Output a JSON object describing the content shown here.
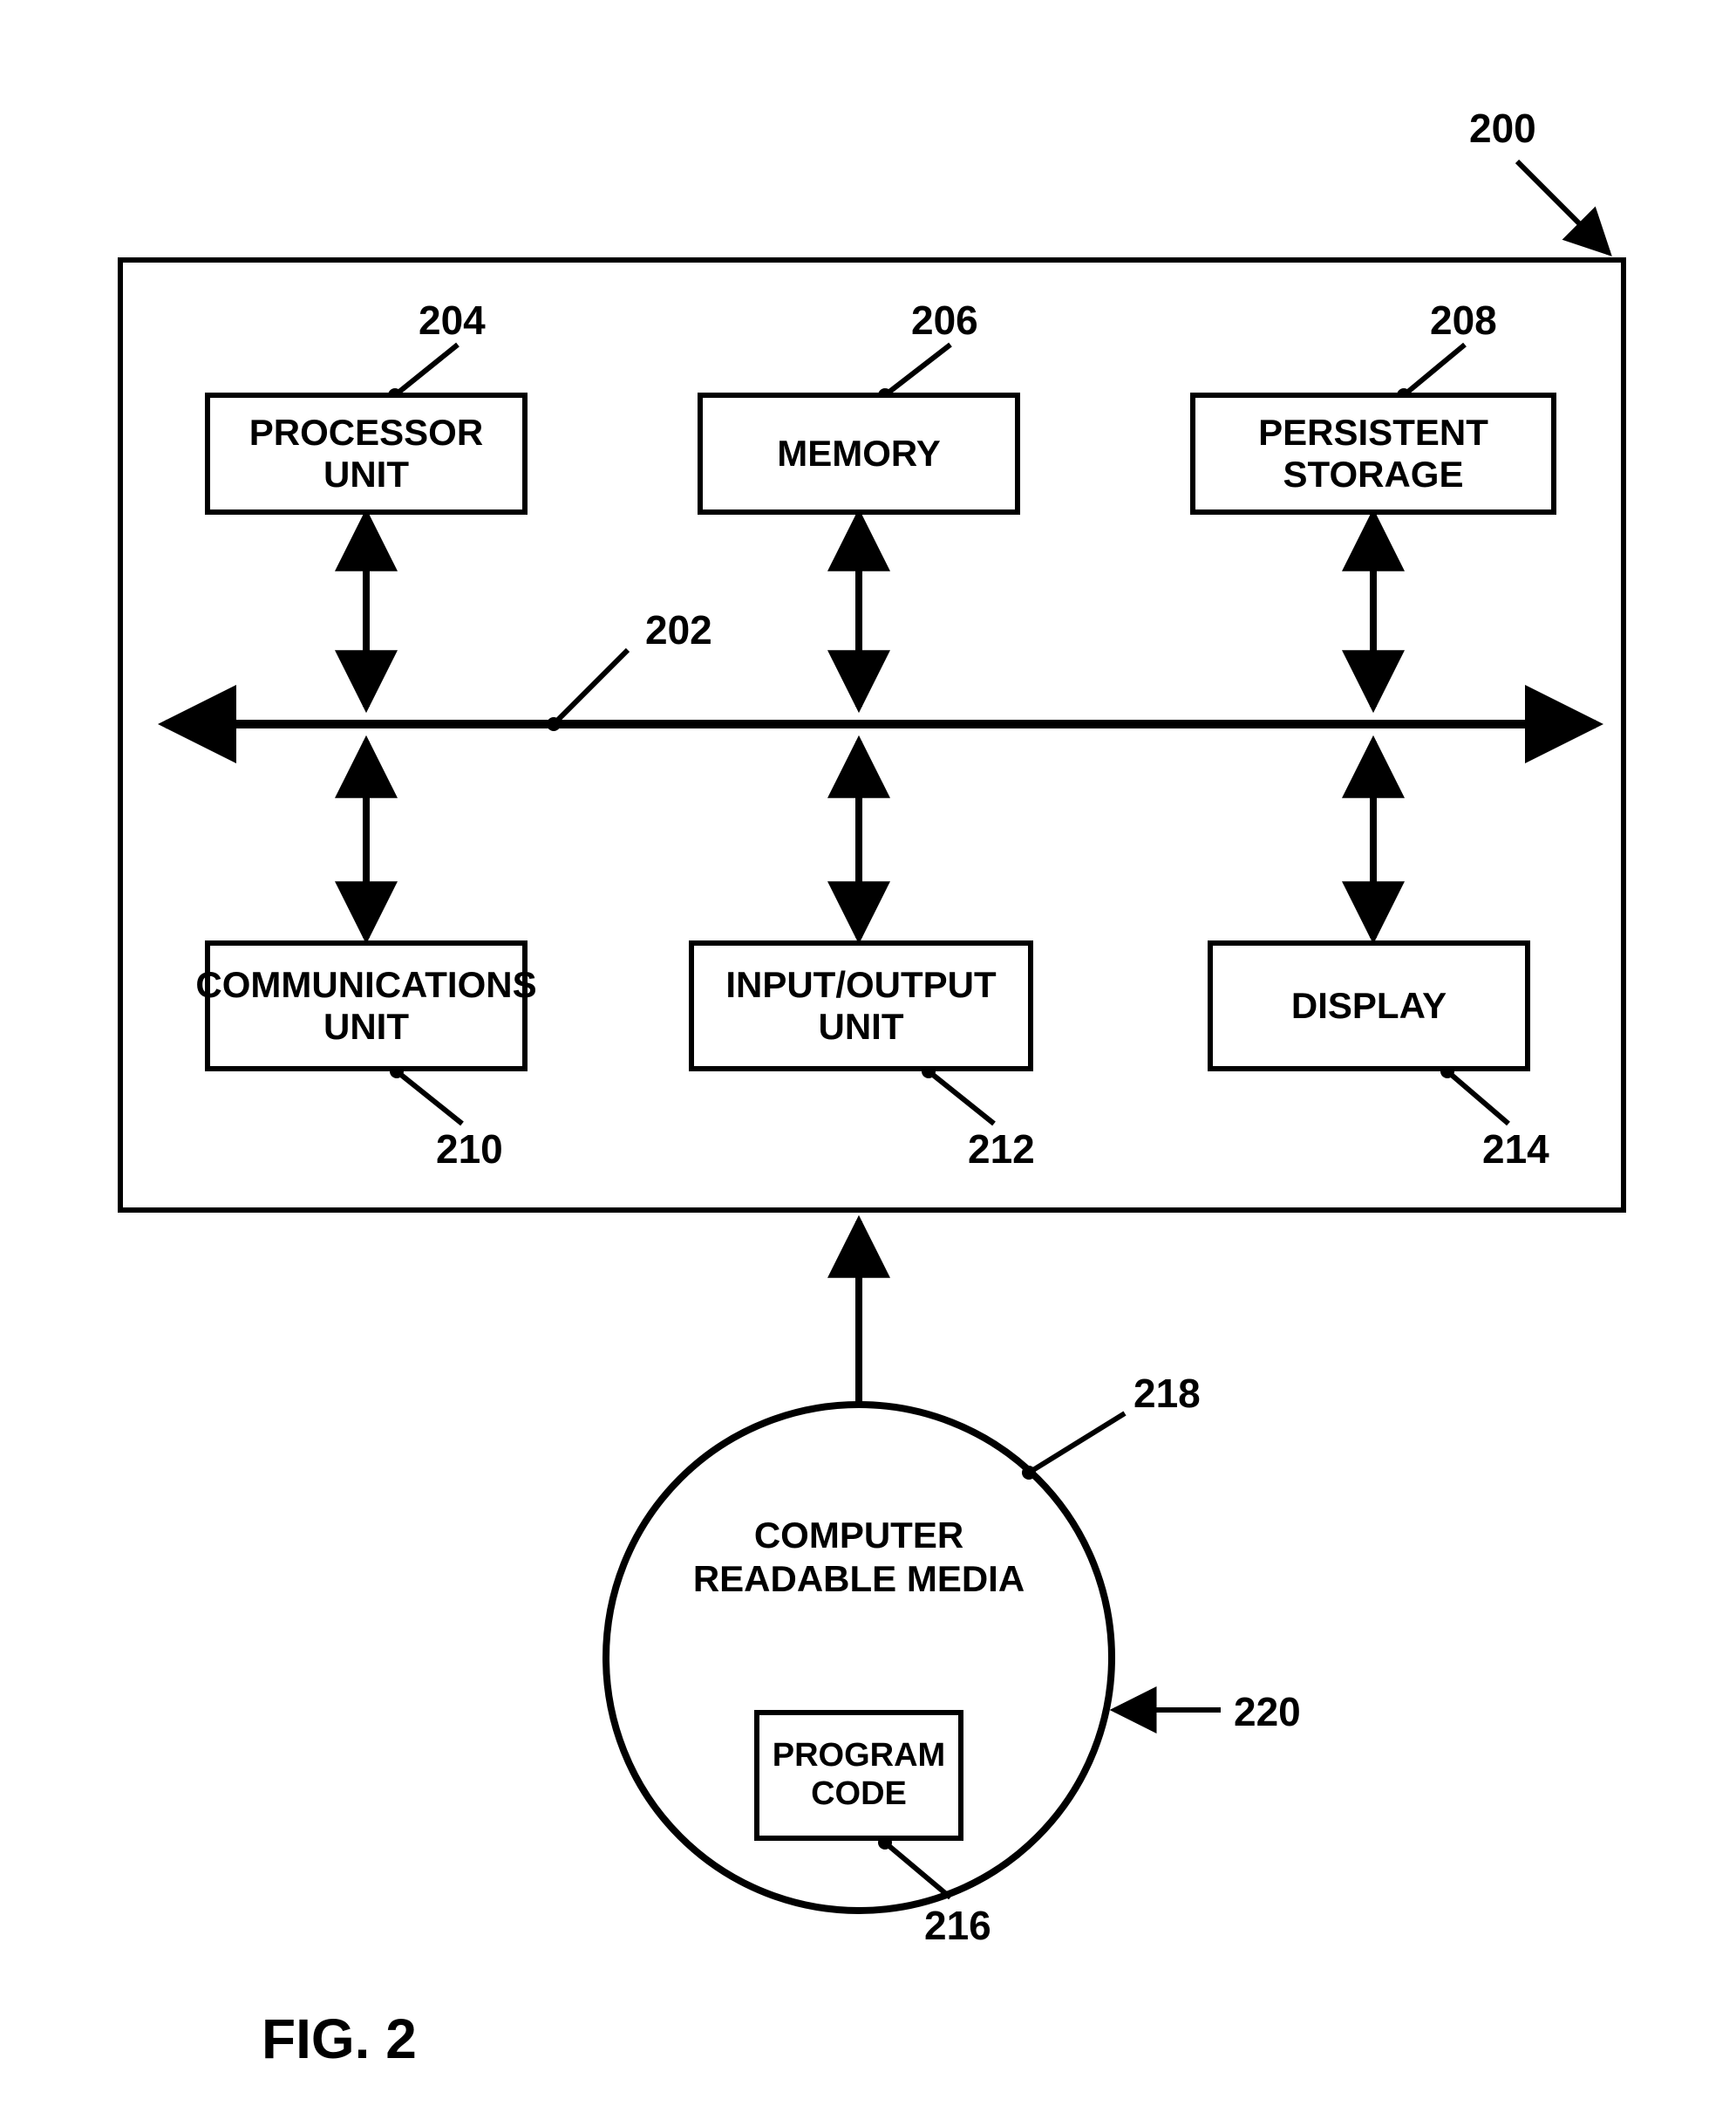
{
  "blocks": {
    "processor": {
      "label": "PROCESSOR UNIT",
      "ref": "204"
    },
    "memory": {
      "label": "MEMORY",
      "ref": "206"
    },
    "storage": {
      "label": "PERSISTENT STORAGE",
      "ref": "208"
    },
    "comm": {
      "label": "COMMUNICATIONS UNIT",
      "ref": "210"
    },
    "io": {
      "label": "INPUT/OUTPUT UNIT",
      "ref": "212"
    },
    "display": {
      "label": "DISPLAY",
      "ref": "214"
    },
    "program": {
      "label": "PROGRAM CODE",
      "ref": "216"
    }
  },
  "circle": {
    "label_line1": "COMPUTER",
    "label_line2": "READABLE MEDIA",
    "ref": "218",
    "product_ref": "220"
  },
  "bus_ref": "202",
  "system_ref": "200",
  "figure": "FIG. 2"
}
